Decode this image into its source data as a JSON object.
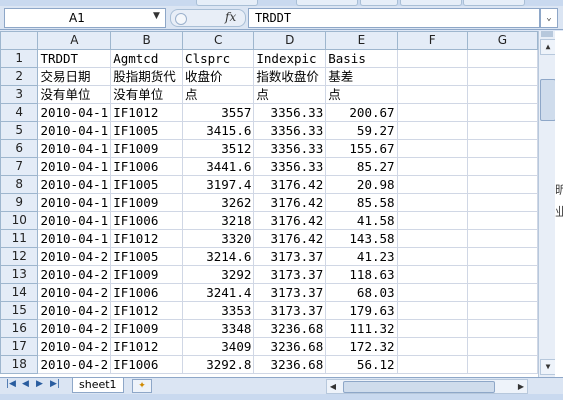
{
  "name_box": {
    "value": "A1"
  },
  "formula_bar": {
    "fx_label": "fx",
    "value": "TRDDT"
  },
  "columns": [
    "A",
    "B",
    "C",
    "D",
    "E",
    "F",
    "G"
  ],
  "rows": [
    {
      "n": "1",
      "a": "TRDDT",
      "b": "Agmtcd",
      "c": "Clsprc",
      "d": "Indexpic",
      "e": "Basis",
      "f": "",
      "g": ""
    },
    {
      "n": "2",
      "a": "交易日期",
      "b": "股指期货代",
      "c": "收盘价",
      "d": "指数收盘价",
      "e": "基差",
      "f": "",
      "g": ""
    },
    {
      "n": "3",
      "a": "没有单位",
      "b": "没有单位",
      "c": "点",
      "d": "点",
      "e": "点",
      "f": "",
      "g": ""
    },
    {
      "n": "4",
      "a": "2010-04-1",
      "b": "IF1012",
      "c": "3557",
      "d": "3356.33",
      "e": "200.67",
      "f": "",
      "g": ""
    },
    {
      "n": "5",
      "a": "2010-04-1",
      "b": "IF1005",
      "c": "3415.6",
      "d": "3356.33",
      "e": "59.27",
      "f": "",
      "g": ""
    },
    {
      "n": "6",
      "a": "2010-04-1",
      "b": "IF1009",
      "c": "3512",
      "d": "3356.33",
      "e": "155.67",
      "f": "",
      "g": ""
    },
    {
      "n": "7",
      "a": "2010-04-1",
      "b": "IF1006",
      "c": "3441.6",
      "d": "3356.33",
      "e": "85.27",
      "f": "",
      "g": ""
    },
    {
      "n": "8",
      "a": "2010-04-1",
      "b": "IF1005",
      "c": "3197.4",
      "d": "3176.42",
      "e": "20.98",
      "f": "",
      "g": ""
    },
    {
      "n": "9",
      "a": "2010-04-1",
      "b": "IF1009",
      "c": "3262",
      "d": "3176.42",
      "e": "85.58",
      "f": "",
      "g": ""
    },
    {
      "n": "10",
      "a": "2010-04-1",
      "b": "IF1006",
      "c": "3218",
      "d": "3176.42",
      "e": "41.58",
      "f": "",
      "g": ""
    },
    {
      "n": "11",
      "a": "2010-04-1",
      "b": "IF1012",
      "c": "3320",
      "d": "3176.42",
      "e": "143.58",
      "f": "",
      "g": ""
    },
    {
      "n": "12",
      "a": "2010-04-2",
      "b": "IF1005",
      "c": "3214.6",
      "d": "3173.37",
      "e": "41.23",
      "f": "",
      "g": ""
    },
    {
      "n": "13",
      "a": "2010-04-2",
      "b": "IF1009",
      "c": "3292",
      "d": "3173.37",
      "e": "118.63",
      "f": "",
      "g": ""
    },
    {
      "n": "14",
      "a": "2010-04-2",
      "b": "IF1006",
      "c": "3241.4",
      "d": "3173.37",
      "e": "68.03",
      "f": "",
      "g": ""
    },
    {
      "n": "15",
      "a": "2010-04-2",
      "b": "IF1012",
      "c": "3353",
      "d": "3173.37",
      "e": "179.63",
      "f": "",
      "g": ""
    },
    {
      "n": "16",
      "a": "2010-04-2",
      "b": "IF1009",
      "c": "3348",
      "d": "3236.68",
      "e": "111.32",
      "f": "",
      "g": ""
    },
    {
      "n": "17",
      "a": "2010-04-2",
      "b": "IF1012",
      "c": "3409",
      "d": "3236.68",
      "e": "172.32",
      "f": "",
      "g": ""
    },
    {
      "n": "18",
      "a": "2010-04-2",
      "b": "IF1006",
      "c": "3292.8",
      "d": "3236.68",
      "e": "56.12",
      "f": "",
      "g": ""
    }
  ],
  "sheet_tabs": [
    {
      "label": "sheet1",
      "active": true
    }
  ],
  "right_edge_glyphs": [
    "昕",
    "业"
  ],
  "colors": {
    "header_bg": "#e4ecf7",
    "grid_line": "#d0d7e5",
    "chrome": "#dbe5f3"
  }
}
